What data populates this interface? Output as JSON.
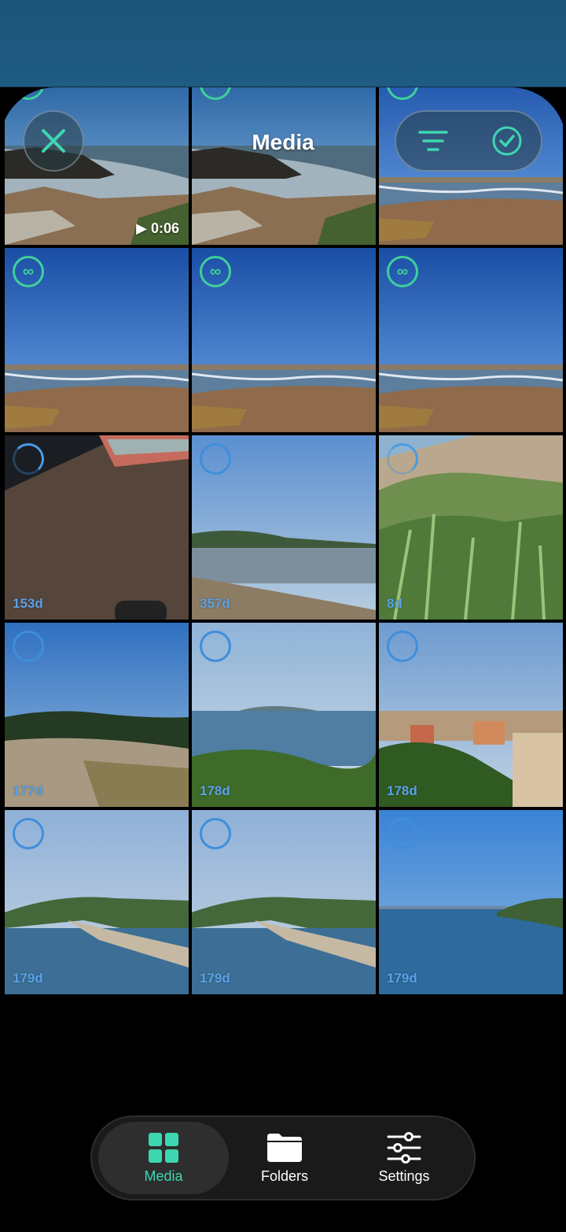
{
  "header": {
    "title": "Media"
  },
  "toolbar": {
    "close_icon": "close-icon",
    "sort_icon": "sort-lines-icon",
    "select_icon": "checkmark-circle-icon"
  },
  "colors": {
    "accent": "#3ed6b0",
    "live_badge": "#3ed09a",
    "select_ring": "#3f8edb",
    "day_label": "#5aa2e8"
  },
  "grid": {
    "items": [
      {
        "scene": "rocky-coast",
        "badge": "live",
        "duration": "0:06",
        "days": ""
      },
      {
        "scene": "rocky-coast",
        "badge": "live",
        "duration": "",
        "days": ""
      },
      {
        "scene": "beach",
        "badge": "live",
        "duration": "",
        "days": ""
      },
      {
        "scene": "beach",
        "badge": "live",
        "duration": "",
        "days": ""
      },
      {
        "scene": "beach",
        "badge": "live",
        "duration": "",
        "days": ""
      },
      {
        "scene": "beach",
        "badge": "live",
        "duration": "",
        "days": ""
      },
      {
        "scene": "object",
        "badge": "loading",
        "duration": "",
        "days": "153d"
      },
      {
        "scene": "lagoon",
        "badge": "empty",
        "duration": "",
        "days": "357d"
      },
      {
        "scene": "shrubs",
        "badge": "loading",
        "duration": "",
        "days": "8d"
      },
      {
        "scene": "hills",
        "badge": "empty",
        "duration": "",
        "days": "177d"
      },
      {
        "scene": "sea-view",
        "badge": "empty",
        "duration": "",
        "days": "178d"
      },
      {
        "scene": "town",
        "badge": "empty",
        "duration": "",
        "days": "178d"
      },
      {
        "scene": "bay",
        "badge": "empty",
        "duration": "",
        "days": "179d"
      },
      {
        "scene": "bay",
        "badge": "empty",
        "duration": "",
        "days": "179d"
      },
      {
        "scene": "blue-sea",
        "badge": "empty",
        "duration": "",
        "days": "179d"
      }
    ],
    "live_symbol": "∞"
  },
  "tabbar": {
    "tabs": [
      {
        "label": "Media",
        "icon": "grid-icon",
        "active": true
      },
      {
        "label": "Folders",
        "icon": "folder-icon",
        "active": false
      },
      {
        "label": "Settings",
        "icon": "sliders-icon",
        "active": false
      }
    ]
  }
}
